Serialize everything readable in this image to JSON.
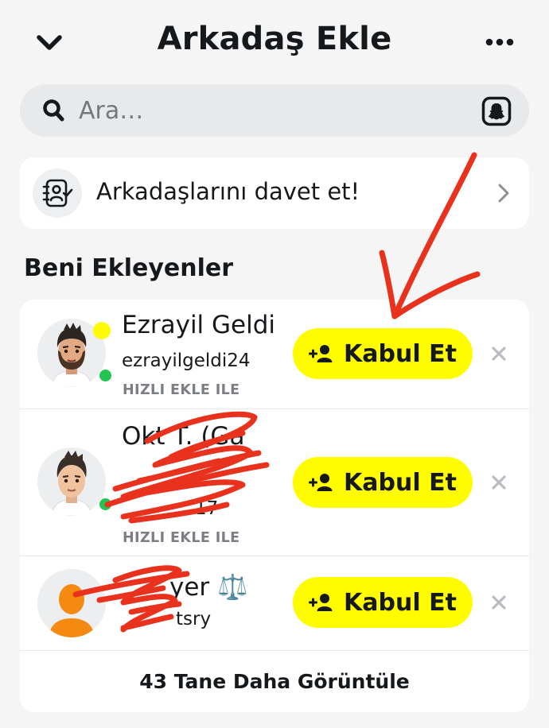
{
  "header": {
    "title": "Arkadaş Ekle",
    "back_icon": "chevron-down-icon",
    "more_icon": "more-horizontal-icon"
  },
  "search": {
    "placeholder": "Ara…",
    "icon": "search-icon",
    "snapcode_icon": "snapcode-icon"
  },
  "invite": {
    "label": "Arkadaşlarını davet et!",
    "icon": "contact-book-icon"
  },
  "section": {
    "title": "Beni Ekleyenler"
  },
  "requests": [
    {
      "name": "Ezrayil Geldi",
      "username": "ezrayilgeldi24",
      "subtitle": "HIZLI EKLE ILE",
      "button_label": "Kabul Et",
      "online": true
    },
    {
      "name": "Okt T. (Ga",
      "username": "17",
      "subtitle": "HIZLI EKLE ILE",
      "button_label": "Kabul Et",
      "online": true
    },
    {
      "name": "yer ⚖️",
      "username": "tsry",
      "subtitle": "",
      "button_label": "Kabul Et",
      "online": false
    }
  ],
  "see_more": {
    "label": "43 Tane Daha Görüntüle"
  },
  "colors": {
    "accent_yellow": "#fffc00",
    "online_green": "#23c552",
    "annotation_red": "#e8321e",
    "background": "#f5f5f6"
  }
}
